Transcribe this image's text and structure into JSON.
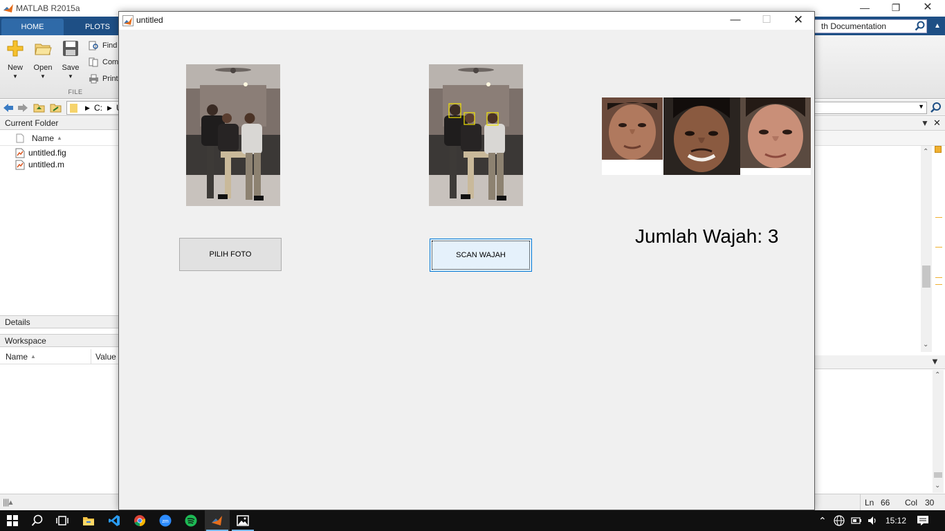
{
  "matlab": {
    "title": "MATLAB R2015a",
    "tabs": [
      "HOME",
      "PLOTS"
    ],
    "search_text": "th Documentation",
    "toolstrip": {
      "new": "New",
      "open": "Open",
      "save": "Save",
      "find": "Find",
      "compare": "Comp",
      "print": "Print",
      "group_label": "FILE"
    },
    "address": {
      "path": "C:",
      "path_more": "U"
    },
    "current_folder": {
      "header": "Current Folder",
      "column": "Name",
      "files": [
        "untitled.fig",
        "untitled.m"
      ]
    },
    "details_header": "Details",
    "workspace": {
      "header": "Workspace",
      "col_name": "Name",
      "col_value": "Value"
    },
    "status": {
      "ln_label": "Ln",
      "ln": "66",
      "col_label": "Col",
      "col": "30"
    }
  },
  "figure": {
    "title": "untitled",
    "buttons": {
      "pick_photo": "PILIH FOTO",
      "scan_faces": "SCAN WAJAH"
    },
    "face_count_label": "Jumlah Wajah: 3"
  },
  "taskbar": {
    "time": "15:12",
    "apps": [
      "start-icon",
      "search-icon",
      "task-view-icon",
      "file-explorer-icon",
      "vscode-icon",
      "chrome-icon",
      "zoom-icon",
      "spotify-icon",
      "matlab-icon",
      "photos-icon"
    ]
  }
}
